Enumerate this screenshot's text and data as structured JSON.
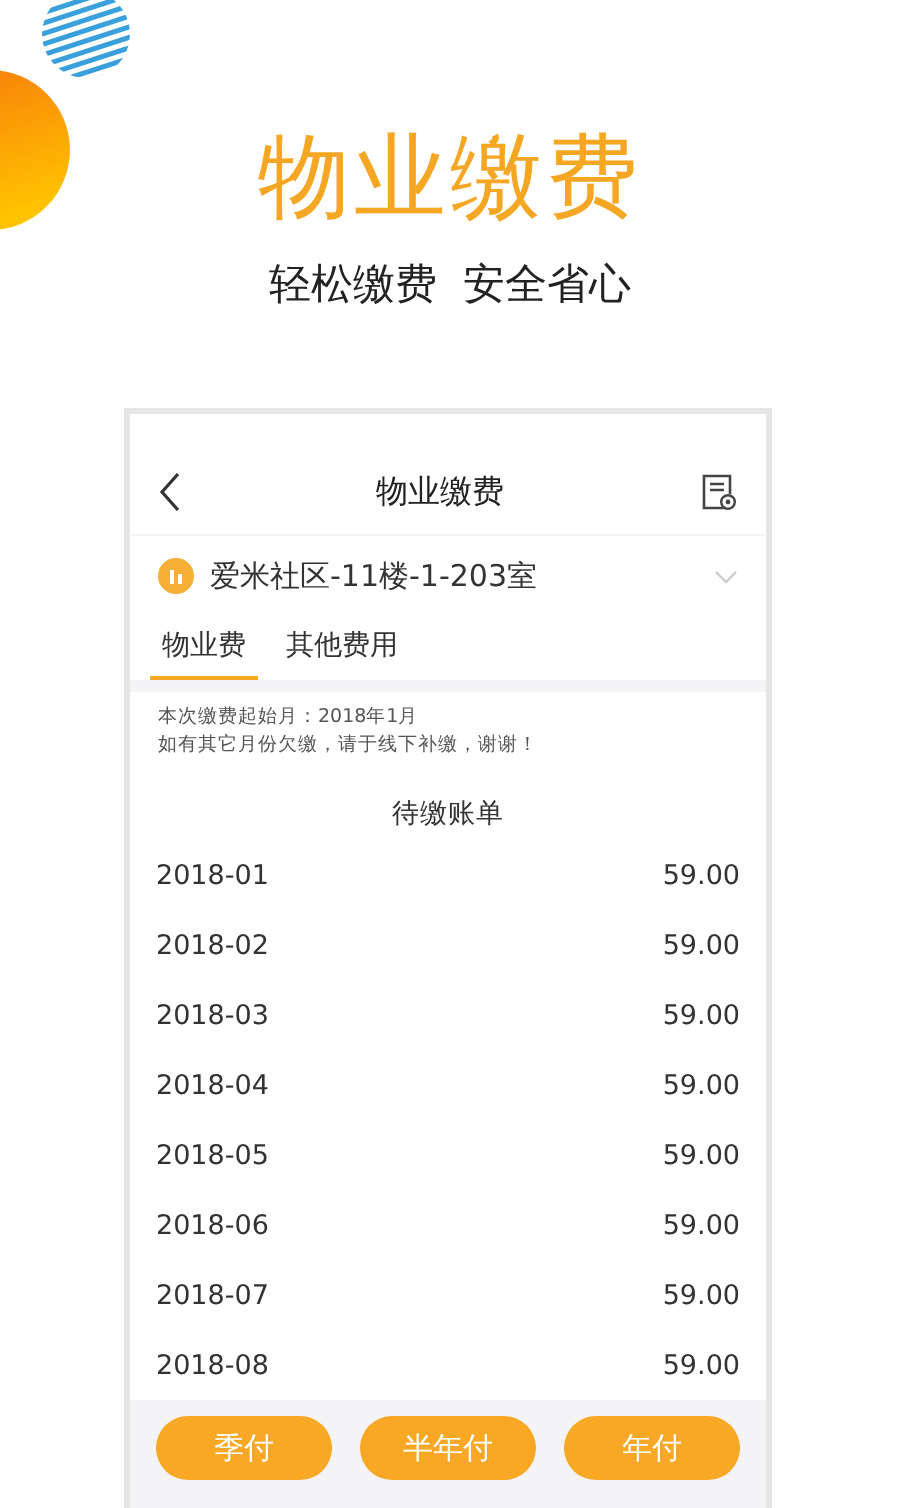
{
  "hero": {
    "title": "物业缴费",
    "subtitle": "轻松缴费  安全省心"
  },
  "header": {
    "title": "物业缴费"
  },
  "address": {
    "text": "爱米社区-11楼-1-203室"
  },
  "tabs": [
    {
      "label": "物业费",
      "selected": true
    },
    {
      "label": "其他费用",
      "selected": false
    }
  ],
  "notice": [
    "本次缴费起始月：2018年1月",
    "如有其它月份欠缴，请于线下补缴，谢谢！"
  ],
  "bill_title": "待缴账单",
  "bills": [
    {
      "month": "2018-01",
      "amount": "59.00"
    },
    {
      "month": "2018-02",
      "amount": "59.00"
    },
    {
      "month": "2018-03",
      "amount": "59.00"
    },
    {
      "month": "2018-04",
      "amount": "59.00"
    },
    {
      "month": "2018-05",
      "amount": "59.00"
    },
    {
      "month": "2018-06",
      "amount": "59.00"
    },
    {
      "month": "2018-07",
      "amount": "59.00"
    },
    {
      "month": "2018-08",
      "amount": "59.00"
    }
  ],
  "buttons": [
    "季付",
    "半年付",
    "年付"
  ]
}
